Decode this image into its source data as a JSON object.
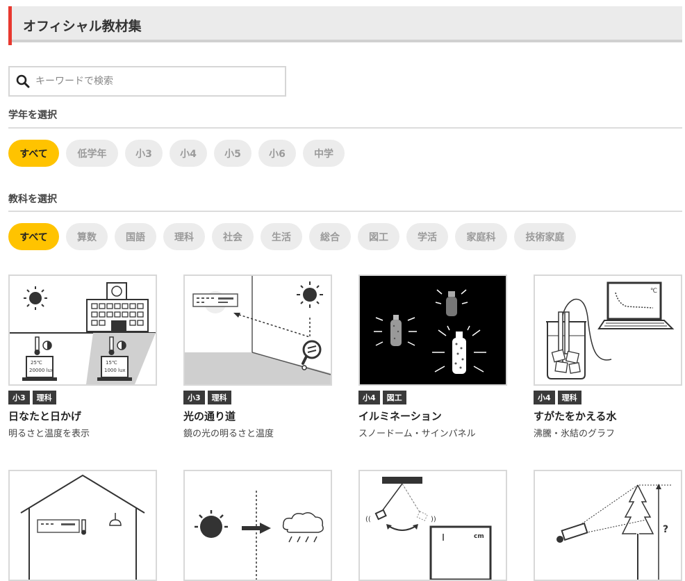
{
  "header": {
    "title": "オフィシャル教材集"
  },
  "search": {
    "placeholder": "キーワードで検索"
  },
  "grade": {
    "label": "学年を選択",
    "options": [
      "すべて",
      "低学年",
      "小3",
      "小4",
      "小5",
      "小6",
      "中学"
    ],
    "selected": "すべて"
  },
  "subject": {
    "label": "教科を選択",
    "options": [
      "すべて",
      "算数",
      "国語",
      "理科",
      "社会",
      "生活",
      "総合",
      "図工",
      "学活",
      "家庭科",
      "技術家庭"
    ],
    "selected": "すべて"
  },
  "colors": {
    "accent": "#ffc300",
    "header_bar": "#e8382f",
    "tag_bg": "#3a3a3a"
  },
  "cards": [
    {
      "grade": "小3",
      "subject": "理科",
      "title": "日なたと日かげ",
      "desc": "明るさと温度を表示",
      "image_text": [
        "25℃",
        "20000 lux",
        "15℃",
        "1000 lux"
      ]
    },
    {
      "grade": "小3",
      "subject": "理科",
      "title": "光の通り道",
      "desc": "鏡の光の明るさと温度"
    },
    {
      "grade": "小4",
      "subject": "図工",
      "title": "イルミネーション",
      "desc": "スノードーム・サインパネル"
    },
    {
      "grade": "小4",
      "subject": "理科",
      "title": "すがたをかえる水",
      "desc": "沸騰・氷結のグラフ",
      "image_text": [
        "℃"
      ]
    },
    {
      "image_text": []
    },
    {
      "image_text": []
    },
    {
      "image_text": [
        "cm"
      ]
    },
    {
      "image_text": [
        "?"
      ]
    }
  ]
}
